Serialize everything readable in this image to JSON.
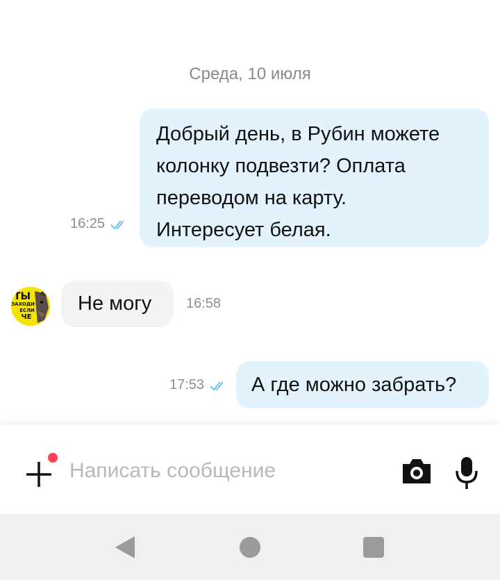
{
  "chat": {
    "date_separator": "Среда, 10 июля",
    "messages": [
      {
        "direction": "outgoing",
        "lines": [
          "Добрый день, в Рубин можете",
          "колонку подвезти? Оплата",
          "переводом на карту.",
          "Интересует белая."
        ],
        "time": "16:25",
        "status_icon": "double-check-icon"
      },
      {
        "direction": "incoming",
        "text": "Не могу",
        "time": "16:58",
        "avatar": "sticker-avatar"
      },
      {
        "direction": "outgoing",
        "text": "А где можно забрать?",
        "time": "17:53",
        "status_icon": "double-check-icon"
      }
    ]
  },
  "avatar": {
    "lines": [
      "ТЫ",
      "ЗАХОДИ",
      "ЕСЛИ",
      "ЧЕ"
    ]
  },
  "composer": {
    "placeholder": "Написать сообщение",
    "value": "",
    "add_icon": "plus-icon",
    "camera_icon": "camera-icon",
    "mic_icon": "microphone-icon"
  },
  "navbar": {
    "back_icon": "back-triangle-icon",
    "home_icon": "home-circle-icon",
    "recent_icon": "recent-square-icon"
  },
  "colors": {
    "outgoing_bubble": "#e3f3fd",
    "incoming_bubble": "#f3f3f3",
    "check": "#6cc3ef",
    "notification_dot": "#ff4053"
  }
}
